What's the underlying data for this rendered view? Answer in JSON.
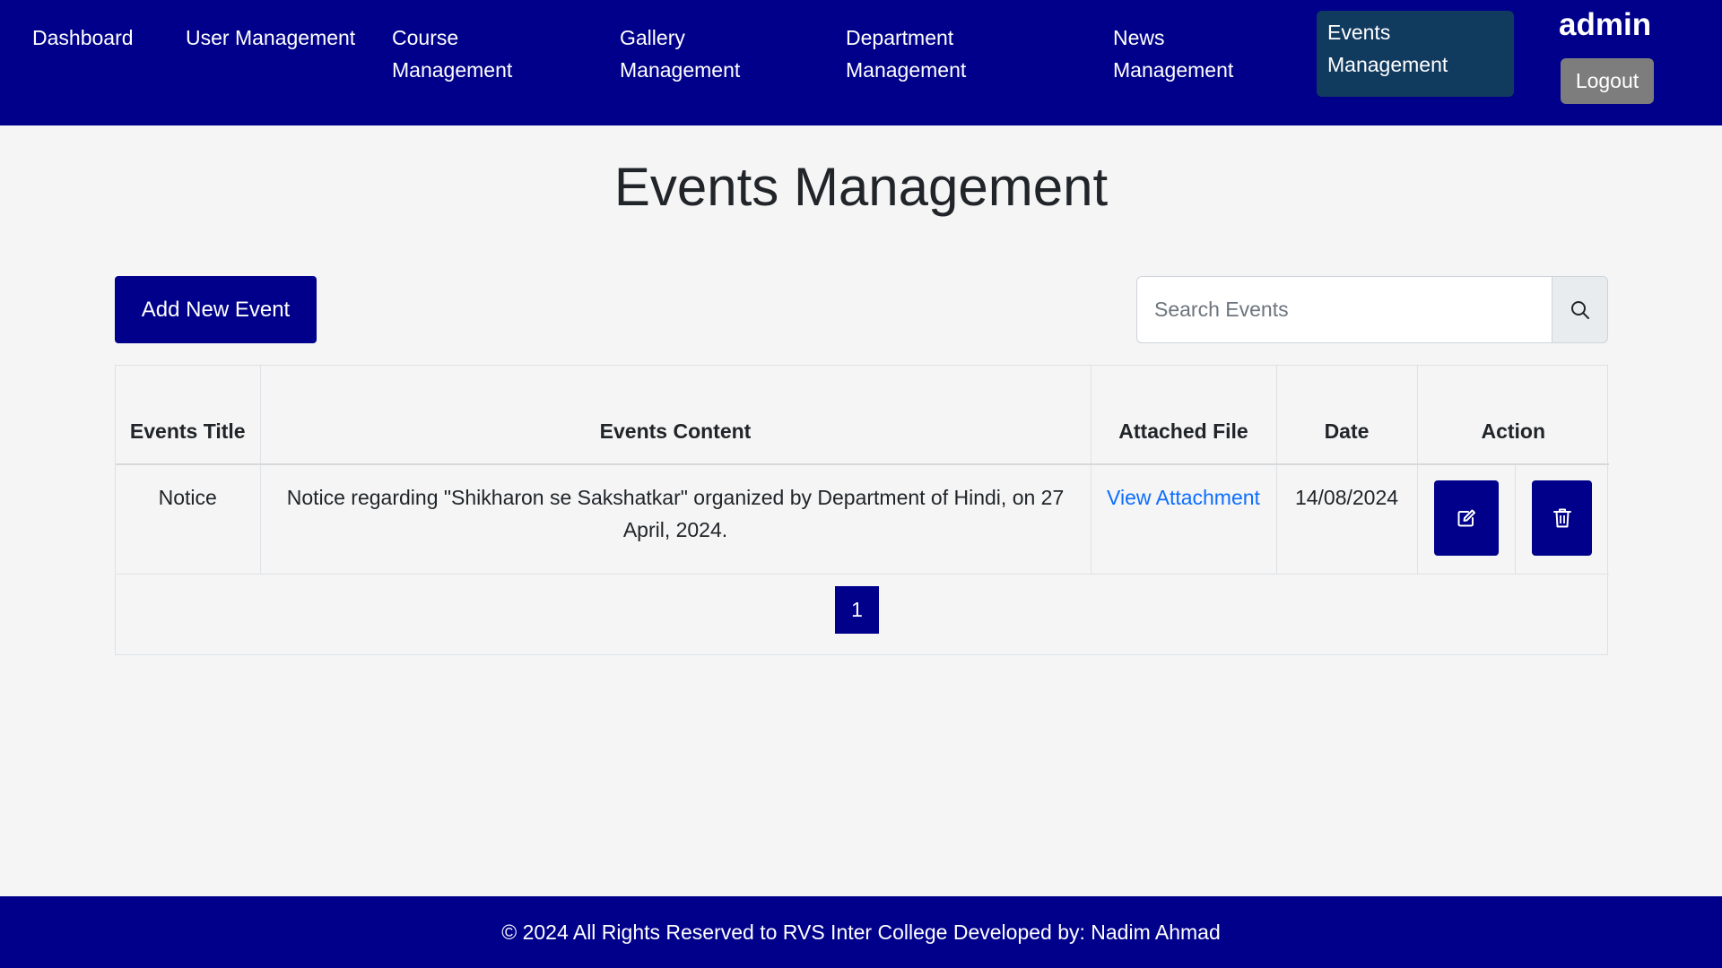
{
  "nav": {
    "items": [
      {
        "label": "Dashboard"
      },
      {
        "label": "User Management"
      },
      {
        "label": "Course Management"
      },
      {
        "label": "Gallery Management"
      },
      {
        "label": "Department Management"
      },
      {
        "label": "News Management"
      },
      {
        "label": "Events Management",
        "active": true
      }
    ],
    "user": "admin",
    "logout_label": "Logout"
  },
  "main": {
    "title": "Events Management",
    "add_button_label": "Add New Event",
    "search": {
      "placeholder": "Search Events",
      "value": "",
      "icon": "search-icon"
    },
    "table": {
      "headers": [
        "Events Title",
        "Events Content",
        "Attached File",
        "Date",
        "Action"
      ],
      "rows": [
        {
          "title": "Notice",
          "content": "Notice regarding \"Shikharon se Sakshatkar\" organized by Department of Hindi, on 27 April, 2024.",
          "attachment_label": "View Attachment",
          "date": "14/08/2024",
          "actions": [
            {
              "icon": "edit-icon"
            },
            {
              "icon": "trash-icon"
            }
          ]
        }
      ]
    },
    "pagination": {
      "current_page": "1"
    }
  },
  "footer": {
    "text": "© 2024 All Rights Reserved to RVS Inter College Developed by: Nadim Ahmad"
  },
  "colors": {
    "primary": "#00008b",
    "active_nav": "#113a5f",
    "link": "#0d6efd",
    "logout": "#7d7d7d",
    "background": "#f5f5f5"
  }
}
